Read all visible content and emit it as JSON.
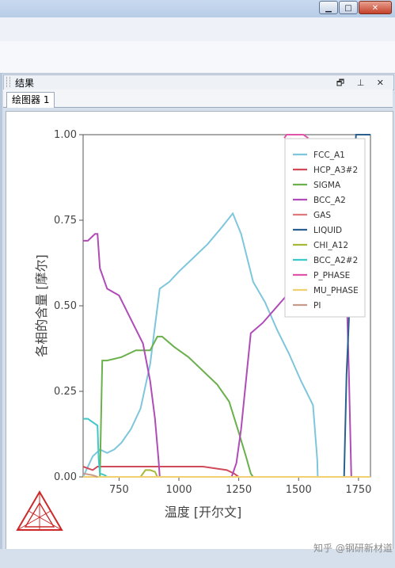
{
  "window": {
    "minimize_glyph": "▁",
    "maximize_glyph": "□",
    "close_glyph": "✕"
  },
  "panel": {
    "title": "结果",
    "icons": "🗗 ⊥ ✕",
    "tab_label": "绘图器 1"
  },
  "chart_data": {
    "type": "line",
    "xlabel": "温度 [开尔文]",
    "ylabel": "各相的含量 [摩尔]",
    "xlim": [
      600,
      1800
    ],
    "ylim": [
      0,
      1
    ],
    "xticks": [
      750,
      1000,
      1250,
      1500,
      1750
    ],
    "xtick_labels": [
      "750",
      "1000",
      "1250",
      "1500",
      "1750"
    ],
    "yticks": [
      0,
      0.25,
      0.5,
      0.75,
      1.0
    ],
    "ytick_labels": [
      "0.00",
      "0.25",
      "0.50",
      "0.75",
      "1.00"
    ],
    "legend_position": "top-right",
    "series": [
      {
        "name": "FCC_A1",
        "color": "#7ec6dc",
        "x": [
          600,
          640,
          670,
          700,
          730,
          760,
          800,
          840,
          880,
          920,
          960,
          1000,
          1060,
          1120,
          1180,
          1225,
          1260,
          1310,
          1360,
          1410,
          1460,
          1510,
          1560,
          1578,
          1580
        ],
        "y": [
          0,
          0.06,
          0.08,
          0.07,
          0.08,
          0.1,
          0.14,
          0.2,
          0.33,
          0.55,
          0.57,
          0.6,
          0.64,
          0.68,
          0.73,
          0.77,
          0.71,
          0.57,
          0.51,
          0.43,
          0.36,
          0.28,
          0.21,
          0.05,
          0
        ]
      },
      {
        "name": "HCP_A3#2",
        "color": "#d04a5a",
        "x": [
          600,
          640,
          660,
          700,
          800,
          900,
          1000,
          1100,
          1200,
          1230,
          1250
        ],
        "y": [
          0.03,
          0.02,
          0.03,
          0.03,
          0.03,
          0.03,
          0.03,
          0.03,
          0.02,
          0.01,
          0
        ]
      },
      {
        "name": "SIGMA",
        "color": "#6ab04c",
        "x": [
          670,
          680,
          700,
          760,
          820,
          860,
          880,
          910,
          930,
          980,
          1040,
          1100,
          1160,
          1210,
          1250,
          1280,
          1300,
          1310
        ],
        "y": [
          0,
          0.34,
          0.34,
          0.35,
          0.37,
          0.37,
          0.37,
          0.41,
          0.41,
          0.38,
          0.35,
          0.31,
          0.27,
          0.22,
          0.13,
          0.06,
          0.01,
          0
        ]
      },
      {
        "name": "BCC_A2",
        "color": "#b04bb8",
        "x": [
          600,
          620,
          650,
          660,
          670,
          680,
          700,
          750,
          800,
          850,
          880,
          900,
          915,
          920,
          1220,
          1240,
          1260,
          1300,
          1350,
          1400,
          1450,
          1520,
          1570,
          1600,
          1680,
          1700,
          1710,
          1720
        ],
        "y": [
          0.69,
          0.69,
          0.71,
          0.71,
          0.61,
          0.59,
          0.55,
          0.53,
          0.46,
          0.39,
          0.28,
          0.17,
          0.05,
          0,
          0,
          0.04,
          0.14,
          0.42,
          0.45,
          0.49,
          0.53,
          0.56,
          0.58,
          0.6,
          0.61,
          0.55,
          0.3,
          0
        ]
      },
      {
        "name": "GAS",
        "color": "#e07a7a",
        "x": [
          600,
          1800
        ],
        "y": [
          0,
          0
        ]
      },
      {
        "name": "LIQUID",
        "color": "#2a5f8f",
        "x": [
          1690,
          1700,
          1710,
          1720,
          1740,
          1760,
          1800
        ],
        "y": [
          0,
          0.3,
          0.46,
          0.8,
          1.0,
          1.0,
          1.0
        ]
      },
      {
        "name": "CHI_A12",
        "color": "#a8b83a",
        "x": [
          840,
          860,
          880,
          900,
          910
        ],
        "y": [
          0,
          0.02,
          0.02,
          0.015,
          0
        ]
      },
      {
        "name": "BCC_A2#2",
        "color": "#3ec8c8",
        "x": [
          600,
          620,
          640,
          660,
          665,
          670,
          690,
          700
        ],
        "y": [
          0.17,
          0.17,
          0.16,
          0.15,
          0.05,
          0.01,
          0.005,
          0
        ]
      },
      {
        "name": "P_PHASE",
        "color": "#e055aa",
        "x": [
          1440,
          1450,
          1460,
          1480,
          1500,
          1520,
          1540
        ],
        "y": [
          0.99,
          1.0,
          1.0,
          1.0,
          1.0,
          1.0,
          0.99
        ]
      },
      {
        "name": "MU_PHASE",
        "color": "#f0d070",
        "x": [
          600,
          1800
        ],
        "y": [
          0,
          0
        ]
      },
      {
        "name": "PI",
        "color": "#c79a8a",
        "x": [
          600,
          640,
          660
        ],
        "y": [
          0.01,
          0.005,
          0
        ]
      }
    ]
  },
  "watermark": "知乎 @钢研新材道"
}
